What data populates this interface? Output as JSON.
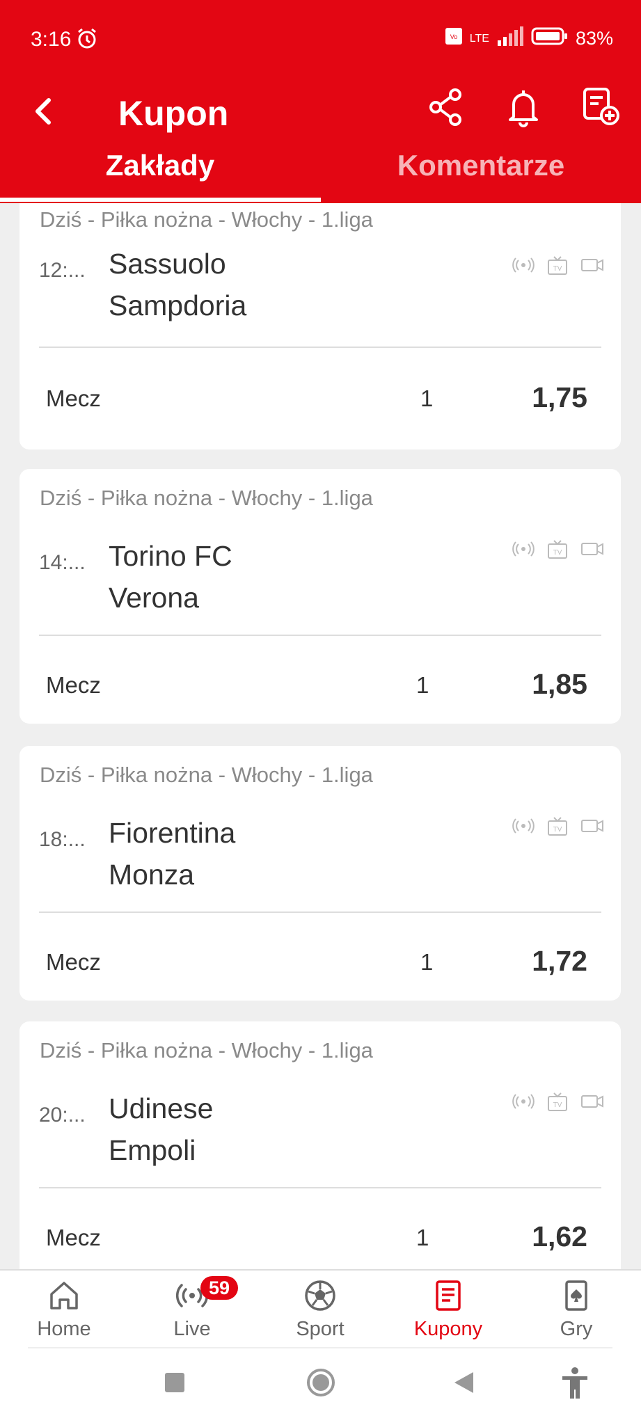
{
  "status_bar": {
    "time": "3:16",
    "network": "LTE",
    "battery": "83%"
  },
  "header": {
    "title": "Kupon"
  },
  "tabs": {
    "bets": "Zakłady",
    "comments": "Komentarze"
  },
  "bets": [
    {
      "league": "Dziś - Piłka nożna - Włochy - 1.liga",
      "time": "12:...",
      "home": "Sassuolo",
      "away": "Sampdoria",
      "market": "Mecz",
      "pick": "1",
      "odds": "1,75"
    },
    {
      "league": "Dziś - Piłka nożna - Włochy - 1.liga",
      "time": "14:...",
      "home": "Torino FC",
      "away": "Verona",
      "market": "Mecz",
      "pick": "1",
      "odds": "1,85"
    },
    {
      "league": "Dziś - Piłka nożna - Włochy - 1.liga",
      "time": "18:...",
      "home": "Fiorentina",
      "away": "Monza",
      "market": "Mecz",
      "pick": "1",
      "odds": "1,72"
    },
    {
      "league": "Dziś - Piłka nożna - Włochy - 1.liga",
      "time": "20:...",
      "home": "Udinese",
      "away": "Empoli",
      "market": "Mecz",
      "pick": "1",
      "odds": "1,62"
    }
  ],
  "bottom_nav": {
    "home": "Home",
    "live": "Live",
    "live_badge": "59",
    "sport": "Sport",
    "coupons": "Kupony",
    "games": "Gry"
  },
  "colors": {
    "brand": "#e30613",
    "background": "#efefef"
  }
}
